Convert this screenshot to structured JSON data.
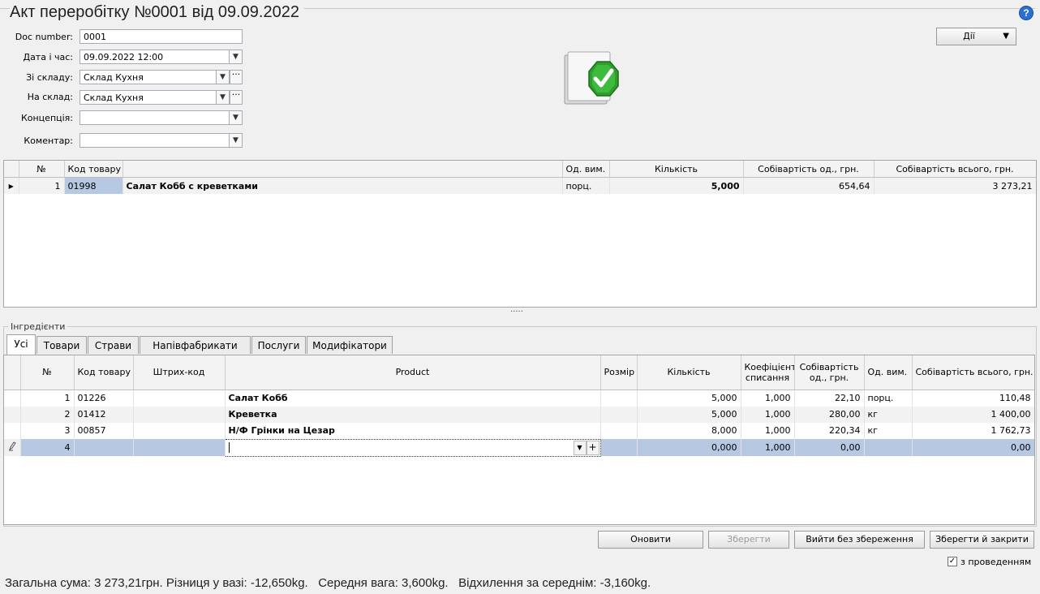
{
  "title": "Акт переробітку №0001 від 09.09.2022",
  "actions_button": "Дії",
  "form": {
    "doc_number": {
      "label": "Doc number:",
      "value": "0001"
    },
    "datetime": {
      "label": "Дата і час:",
      "value": "09.09.2022 12:00"
    },
    "from_store": {
      "label": "Зі складу:",
      "value": "Склад Кухня"
    },
    "to_store": {
      "label": "На склад:",
      "value": "Склад Кухня"
    },
    "concept": {
      "label": "Концепція:",
      "value": ""
    },
    "comment": {
      "label": "Коментар:",
      "value": ""
    }
  },
  "product_table": {
    "headers": [
      "№",
      "Код товару",
      "",
      "Од. вим.",
      "Кількість",
      "Собівартість од., грн.",
      "Собівартість всього, грн."
    ],
    "rows": [
      {
        "num": "1",
        "code": "01998",
        "name": "Салат Кобб с креветками",
        "unit": "порц.",
        "qty": "5,000",
        "unit_cost": "654,64",
        "total_cost": "3 273,21"
      }
    ]
  },
  "splitter": ".....",
  "ingredients": {
    "group_label": "Інгредієнти",
    "tabs": [
      "Усі",
      "Товари",
      "Страви",
      "Напівфабрикати",
      "Послуги",
      "Модифікатори"
    ],
    "headers": {
      "num": "№",
      "code": "Код товару",
      "barcode": "Штрих-код",
      "product": "Product",
      "size": "Розмір",
      "qty": "Кількість",
      "coef": "Коефіцієнт списання",
      "unit_cost": "Собівартість од., грн.",
      "unit": "Од. вим.",
      "total": "Собівартість всього, грн."
    },
    "rows": [
      {
        "num": "1",
        "code": "01226",
        "barcode": "",
        "product": "Салат Кобб",
        "size": "",
        "qty": "5,000",
        "coef": "1,000",
        "unit_cost": "22,10",
        "unit": "порц.",
        "total": "110,48"
      },
      {
        "num": "2",
        "code": "01412",
        "barcode": "",
        "product": "Креветка",
        "size": "",
        "qty": "5,000",
        "coef": "1,000",
        "unit_cost": "280,00",
        "unit": "кг",
        "total": "1 400,00"
      },
      {
        "num": "3",
        "code": "00857",
        "barcode": "",
        "product": "Н/Ф Грінки на Цезар",
        "size": "",
        "qty": "8,000",
        "coef": "1,000",
        "unit_cost": "220,34",
        "unit": "кг",
        "total": "1 762,73"
      },
      {
        "num": "4",
        "code": "",
        "barcode": "",
        "product": "",
        "size": "",
        "qty": "0,000",
        "coef": "1,000",
        "unit_cost": "0,00",
        "unit": "",
        "total": "0,00"
      }
    ]
  },
  "buttons": {
    "refresh": "Оновити",
    "save": "Зберегти",
    "exit": "Вийти без збереження",
    "save_close": "Зберегти й закрити"
  },
  "post_checkbox": {
    "label": "з проведенням",
    "checked": true
  },
  "footer": "Загальна сума: 3 273,21грн. Різниця у вазі: -12,650kg.   Середня вага: 3,600kg.   Відхилення за середнім: -3,160kg."
}
